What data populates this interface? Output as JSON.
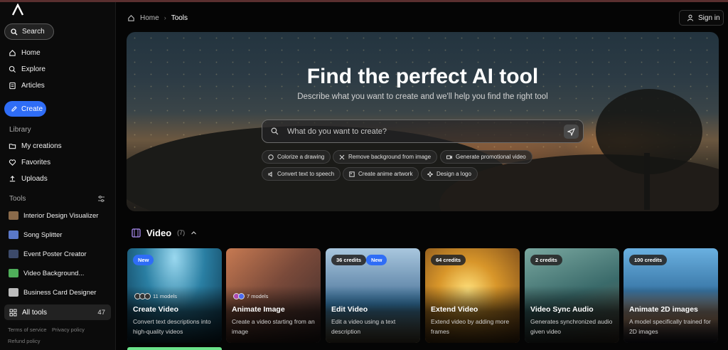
{
  "sidebar": {
    "search_label": "Search",
    "nav": [
      {
        "label": "Home",
        "icon": "home-icon"
      },
      {
        "label": "Explore",
        "icon": "explore-icon"
      },
      {
        "label": "Articles",
        "icon": "articles-icon"
      }
    ],
    "create_label": "Create",
    "library_label": "Library",
    "library": [
      {
        "label": "My creations",
        "icon": "folder-icon"
      },
      {
        "label": "Favorites",
        "icon": "heart-icon"
      },
      {
        "label": "Uploads",
        "icon": "upload-icon"
      }
    ],
    "tools_label": "Tools",
    "tools": [
      {
        "label": "Interior Design Visualizer",
        "color": "#8a6a4a"
      },
      {
        "label": "Song Splitter",
        "color": "#5a78c8"
      },
      {
        "label": "Event Poster Creator",
        "color": "#3c4a6a"
      },
      {
        "label": "Video Background...",
        "color": "#4fae5a"
      },
      {
        "label": "Business Card Designer",
        "color": "#bcbcbc"
      }
    ],
    "all_tools": {
      "label": "All tools",
      "count": "47"
    },
    "footer": {
      "terms": "Terms of service",
      "privacy": "Privacy policy",
      "refund": "Refund policy"
    }
  },
  "header": {
    "breadcrumb": {
      "home": "Home",
      "current": "Tools"
    },
    "signin": "Sign in"
  },
  "hero": {
    "title": "Find the perfect AI tool",
    "subtitle": "Describe what you want to create and we'll help you find the right tool",
    "search_placeholder": "What do you want to create?",
    "chips": [
      {
        "label": "Colorize a drawing",
        "icon": "palette-icon"
      },
      {
        "label": "Remove background from image",
        "icon": "scissors-icon"
      },
      {
        "label": "Generate promotional video",
        "icon": "video-icon"
      },
      {
        "label": "Convert text to speech",
        "icon": "speaker-icon"
      },
      {
        "label": "Create anime artwork",
        "icon": "image-icon"
      },
      {
        "label": "Design a logo",
        "icon": "sparkle-icon"
      }
    ]
  },
  "section": {
    "title": "Video",
    "count": "(7)"
  },
  "cards": [
    {
      "title": "Create Video",
      "desc": "Convert text descriptions into high-quality videos",
      "badges": [
        "New"
      ],
      "models": "11 models",
      "bg": "#2a7fa3"
    },
    {
      "title": "Animate Image",
      "desc": "Create a video starting from an image",
      "badges": [],
      "models": "7 models",
      "bg": "#7a4a3a"
    },
    {
      "title": "Edit Video",
      "desc": "Edit a video using a text description",
      "badges": [
        "36 credits",
        "New"
      ],
      "models": "",
      "bg": "#4a6a8a"
    },
    {
      "title": "Extend Video",
      "desc": "Extend video by adding more frames",
      "badges": [
        "64 credits"
      ],
      "models": "",
      "bg": "#b07a2a"
    },
    {
      "title": "Video Sync Audio",
      "desc": "Generates synchronized audio given video",
      "badges": [
        "2 credits"
      ],
      "models": "",
      "bg": "#3a6a6a"
    },
    {
      "title": "Animate 2D images",
      "desc": "A model specifically trained for 2D images",
      "badges": [
        "100 credits"
      ],
      "models": "",
      "bg": "#3a78a8"
    }
  ]
}
